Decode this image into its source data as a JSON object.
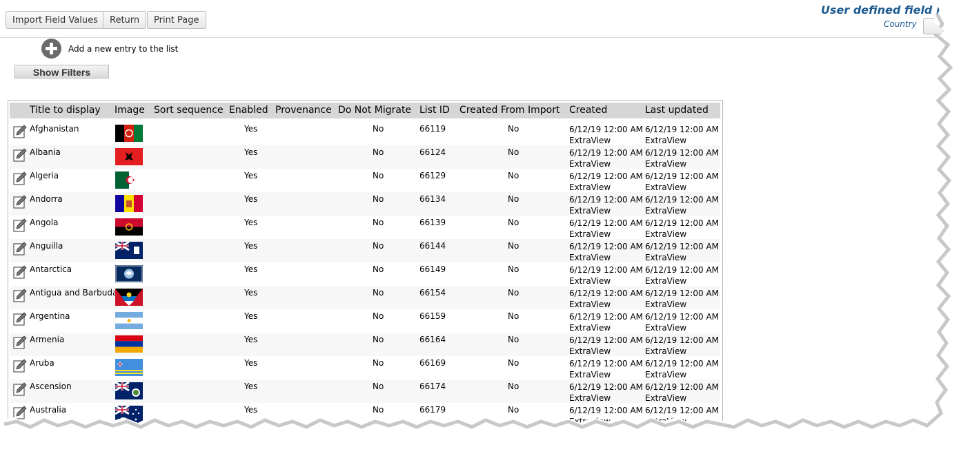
{
  "toolbar": {
    "import_label": "Import Field Values",
    "return_label": "Return",
    "print_label": "Print Page"
  },
  "header": {
    "title": "User defined field li",
    "subtitle": "Country"
  },
  "add_entry": {
    "label": "Add a new entry to the list"
  },
  "filters": {
    "label": "Show Filters"
  },
  "columns": [
    "Title to display",
    "Image",
    "Sort sequence",
    "Enabled",
    "Provenance",
    "Do Not Migrate",
    "List ID",
    "Created From Import",
    "Created",
    "Last updated"
  ],
  "rows": [
    {
      "title": "Afghanistan",
      "flag": "afghanistan-flag",
      "enabled": "Yes",
      "do_not_migrate": "No",
      "list_id": "66119",
      "created_from_import": "No",
      "created": "6/12/19 12:00 AM",
      "created_by": "ExtraView",
      "updated": "6/12/19 12:00 AM",
      "updated_by": "ExtraView"
    },
    {
      "title": "Albania",
      "flag": "albania-flag",
      "enabled": "Yes",
      "do_not_migrate": "No",
      "list_id": "66124",
      "created_from_import": "No",
      "created": "6/12/19 12:00 AM",
      "created_by": "ExtraView",
      "updated": "6/12/19 12:00 AM",
      "updated_by": "ExtraView"
    },
    {
      "title": "Algeria",
      "flag": "algeria-flag",
      "enabled": "Yes",
      "do_not_migrate": "No",
      "list_id": "66129",
      "created_from_import": "No",
      "created": "6/12/19 12:00 AM",
      "created_by": "ExtraView",
      "updated": "6/12/19 12:00 AM",
      "updated_by": "ExtraView"
    },
    {
      "title": "Andorra",
      "flag": "andorra-flag",
      "enabled": "Yes",
      "do_not_migrate": "No",
      "list_id": "66134",
      "created_from_import": "No",
      "created": "6/12/19 12:00 AM",
      "created_by": "ExtraView",
      "updated": "6/12/19 12:00 AM",
      "updated_by": "ExtraView"
    },
    {
      "title": "Angola",
      "flag": "angola-flag",
      "enabled": "Yes",
      "do_not_migrate": "No",
      "list_id": "66139",
      "created_from_import": "No",
      "created": "6/12/19 12:00 AM",
      "created_by": "ExtraView",
      "updated": "6/12/19 12:00 AM",
      "updated_by": "ExtraView"
    },
    {
      "title": "Anguilla",
      "flag": "anguilla-flag",
      "enabled": "Yes",
      "do_not_migrate": "No",
      "list_id": "66144",
      "created_from_import": "No",
      "created": "6/12/19 12:00 AM",
      "created_by": "ExtraView",
      "updated": "6/12/19 12:00 AM",
      "updated_by": "ExtraView"
    },
    {
      "title": "Antarctica",
      "flag": "antarctica-flag",
      "enabled": "Yes",
      "do_not_migrate": "No",
      "list_id": "66149",
      "created_from_import": "No",
      "created": "6/12/19 12:00 AM",
      "created_by": "ExtraView",
      "updated": "6/12/19 12:00 AM",
      "updated_by": "ExtraView"
    },
    {
      "title": "Antigua and Barbuda",
      "flag": "antigua-and-barbuda-flag",
      "enabled": "Yes",
      "do_not_migrate": "No",
      "list_id": "66154",
      "created_from_import": "No",
      "created": "6/12/19 12:00 AM",
      "created_by": "ExtraView",
      "updated": "6/12/19 12:00 AM",
      "updated_by": "ExtraView"
    },
    {
      "title": "Argentina",
      "flag": "argentina-flag",
      "enabled": "Yes",
      "do_not_migrate": "No",
      "list_id": "66159",
      "created_from_import": "No",
      "created": "6/12/19 12:00 AM",
      "created_by": "ExtraView",
      "updated": "6/12/19 12:00 AM",
      "updated_by": "ExtraView"
    },
    {
      "title": "Armenia",
      "flag": "armenia-flag",
      "enabled": "Yes",
      "do_not_migrate": "No",
      "list_id": "66164",
      "created_from_import": "No",
      "created": "6/12/19 12:00 AM",
      "created_by": "ExtraView",
      "updated": "6/12/19 12:00 AM",
      "updated_by": "ExtraView"
    },
    {
      "title": "Aruba",
      "flag": "aruba-flag",
      "enabled": "Yes",
      "do_not_migrate": "No",
      "list_id": "66169",
      "created_from_import": "No",
      "created": "6/12/19 12:00 AM",
      "created_by": "ExtraView",
      "updated": "6/12/19 12:00 AM",
      "updated_by": "ExtraView"
    },
    {
      "title": "Ascension",
      "flag": "ascension-flag",
      "enabled": "Yes",
      "do_not_migrate": "No",
      "list_id": "66174",
      "created_from_import": "No",
      "created": "6/12/19 12:00 AM",
      "created_by": "ExtraView",
      "updated": "6/12/19 12:00 AM",
      "updated_by": "ExtraView"
    },
    {
      "title": "Australia",
      "flag": "australia-flag",
      "enabled": "Yes",
      "do_not_migrate": "No",
      "list_id": "66179",
      "created_from_import": "No",
      "created": "6/12/19 12:00 AM",
      "created_by": "ExtraView",
      "updated": "6/12/19 12:00 AM",
      "updated_by": "ExtraView"
    }
  ],
  "colors": {
    "title": "#1c5a8f",
    "header_bg": "#d6d6d6",
    "row_alt": "#f7f7f7"
  }
}
